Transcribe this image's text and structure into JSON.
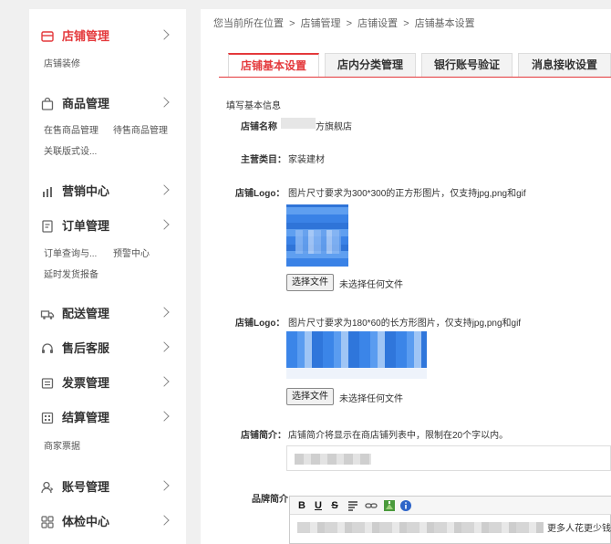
{
  "sidebar": {
    "sections": [
      {
        "title": "店铺管理",
        "icon": "shop-icon",
        "subs": [
          "店铺装修"
        ]
      },
      {
        "title": "商品管理",
        "icon": "bag-icon",
        "subs": [
          "在售商品管理",
          "待售商品管理",
          "关联版式设..."
        ]
      },
      {
        "title": "营销中心",
        "icon": "chart-icon",
        "subs": []
      },
      {
        "title": "订单管理",
        "icon": "order-icon",
        "subs": [
          "订单查询与...",
          "预警中心",
          "延时发货报备"
        ]
      },
      {
        "title": "配送管理",
        "icon": "truck-icon",
        "subs": []
      },
      {
        "title": "售后客服",
        "icon": "headset-icon",
        "subs": []
      },
      {
        "title": "发票管理",
        "icon": "invoice-icon",
        "subs": []
      },
      {
        "title": "结算管理",
        "icon": "settlement-icon",
        "subs": [
          "商家票据"
        ]
      },
      {
        "title": "账号管理",
        "icon": "user-icon",
        "subs": []
      },
      {
        "title": "体检中心",
        "icon": "grid-icon",
        "subs": []
      }
    ]
  },
  "breadcrumb": [
    "您当前所在位置",
    ">",
    "店铺管理",
    ">",
    "店铺设置",
    ">",
    "店铺基本设置"
  ],
  "tabs": [
    "店铺基本设置",
    "店内分类管理",
    "银行账号验证",
    "消息接收设置"
  ],
  "form": {
    "section_title": "填写基本信息",
    "shop_name_label": "店铺名称",
    "shop_name_value": "方旗舰店",
    "category_label": "主营类目：",
    "category_value": "家装建材",
    "logo_label": "店铺Logo：",
    "logo1_hint": "图片尺寸要求为300*300的正方形图片，仅支持jpg,png和gif",
    "logo2_hint": "图片尺寸要求为180*60的长方形图片，仅支持jpg,png和gif",
    "choose_file": "选择文件",
    "no_file": "未选择任何文件",
    "intro_label": "店铺简介：",
    "intro_hint": "店铺简介将显示在商店铺列表中，限制在20个字以内。",
    "brand_label": "品牌简介",
    "editor_tail": "更多人花更少钱",
    "editor_tools": [
      "B",
      "U",
      "S"
    ]
  }
}
